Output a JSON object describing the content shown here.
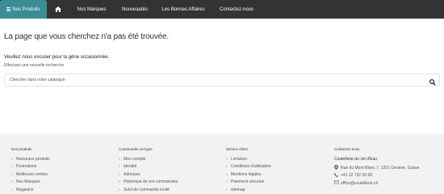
{
  "nav": {
    "products": "Nos Produits",
    "home_icon": "home-icon",
    "brands": "Nos Marques",
    "news": "Nouveautés",
    "deals": "Les Bonnes Affaires",
    "contact": "Contactez-nous"
  },
  "main": {
    "title": "La page que vous cherchez n'a pas été trouvée.",
    "apology": "Veuillez nous excuser pour la gêne occasionnée.",
    "suggestion": "Effectuez une nouvelle recherche",
    "search_placeholder": "Chercher dans notre catalogue"
  },
  "footer": {
    "products": {
      "heading": "Nos produits",
      "items": [
        "Nouveaux produits",
        "Promotions",
        "Meilleures ventes",
        "Nos Marques",
        "Magasins"
      ]
    },
    "orders": {
      "heading": "Commander en ligne",
      "items": [
        "Mon compte",
        "Identité",
        "Adresses",
        "Historique de vos commandes",
        "Suivi de commande invité"
      ]
    },
    "service": {
      "heading": "Service client",
      "items": [
        "Livraison",
        "Conditions d'utilisation",
        "Mentions légales",
        "Paiement sécurisé",
        "sitemap"
      ]
    },
    "contact": {
      "heading": "Contactez-nous",
      "company": "Coutellerie du Jet d'Eau",
      "address": "Rue du Mont-Blanc 7, 1201 Genève, Suisse",
      "phone": "+41 22 732 26 68",
      "email": "office@coutellerie.ch"
    }
  }
}
